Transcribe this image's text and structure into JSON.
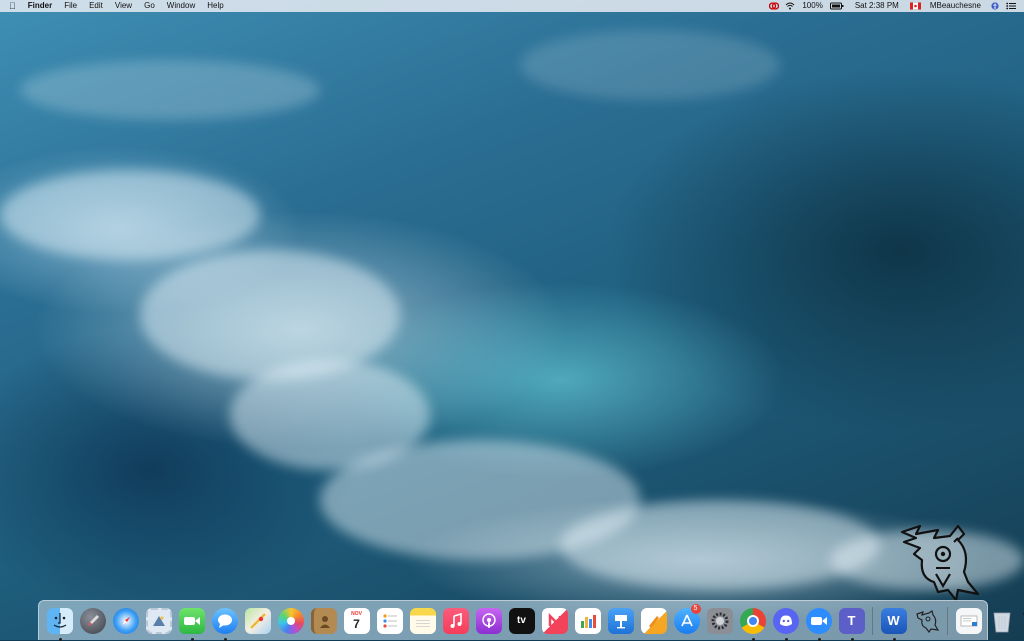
{
  "menubar": {
    "app_name": "Finder",
    "menus": [
      "File",
      "Edit",
      "View",
      "Go",
      "Window",
      "Help"
    ],
    "battery": "100%",
    "clock": "Sat 2:38 PM",
    "user": "MBeauchesne"
  },
  "dock": {
    "calendar": {
      "month": "NOV",
      "day": "7"
    },
    "appstore_badge": "5",
    "word_letter": "W",
    "teams_letter": "T",
    "tv_label": "tv"
  }
}
